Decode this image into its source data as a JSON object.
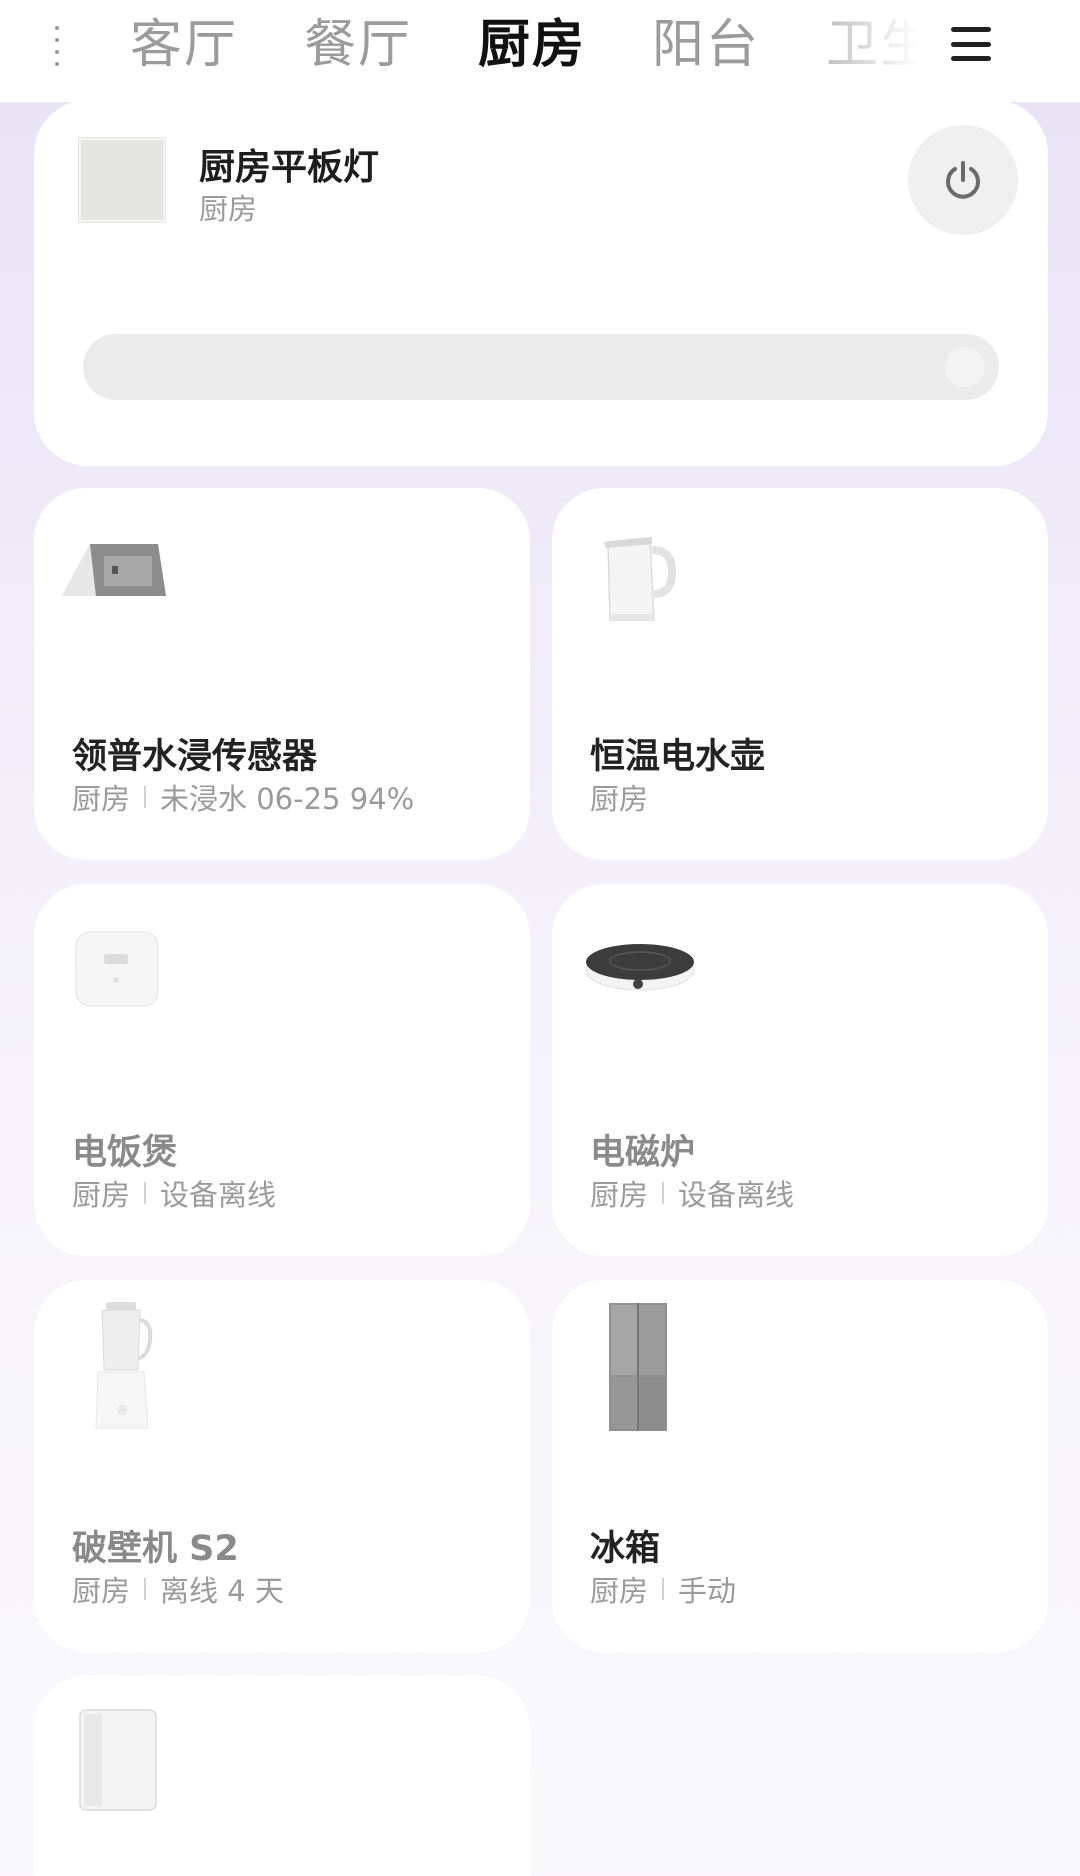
{
  "tabs": [
    "客厅",
    "餐厅",
    "厨房",
    "阳台",
    "卫生间"
  ],
  "active_tab": "厨房",
  "featured": {
    "name": "厨房平板灯",
    "room": "厨房",
    "brightness_percent": 100,
    "icon": "power-icon"
  },
  "devices": [
    {
      "name": "领普水浸传感器",
      "room": "厨房",
      "status": "未浸水 06-25 94%",
      "offline": false,
      "icon": "water-sensor-icon"
    },
    {
      "name": "恒温电水壶",
      "room": "厨房",
      "status": "",
      "offline": false,
      "icon": "kettle-icon"
    },
    {
      "name": "电饭煲",
      "room": "厨房",
      "status": "设备离线",
      "offline": true,
      "icon": "rice-cooker-icon"
    },
    {
      "name": "电磁炉",
      "room": "厨房",
      "status": "设备离线",
      "offline": true,
      "icon": "induction-cooker-icon"
    },
    {
      "name": "破壁机 S2",
      "room": "厨房",
      "status": "离线 4 天",
      "offline": true,
      "icon": "blender-icon"
    },
    {
      "name": "冰箱",
      "room": "厨房",
      "status": "手动",
      "offline": false,
      "icon": "fridge-icon"
    },
    {
      "name": "",
      "room": "",
      "status": "",
      "offline": false,
      "icon": "water-purifier-icon"
    }
  ],
  "colors": {
    "active_tab": "#111111",
    "inactive_tab": "#9b9b9b",
    "card": "#ffffff"
  }
}
